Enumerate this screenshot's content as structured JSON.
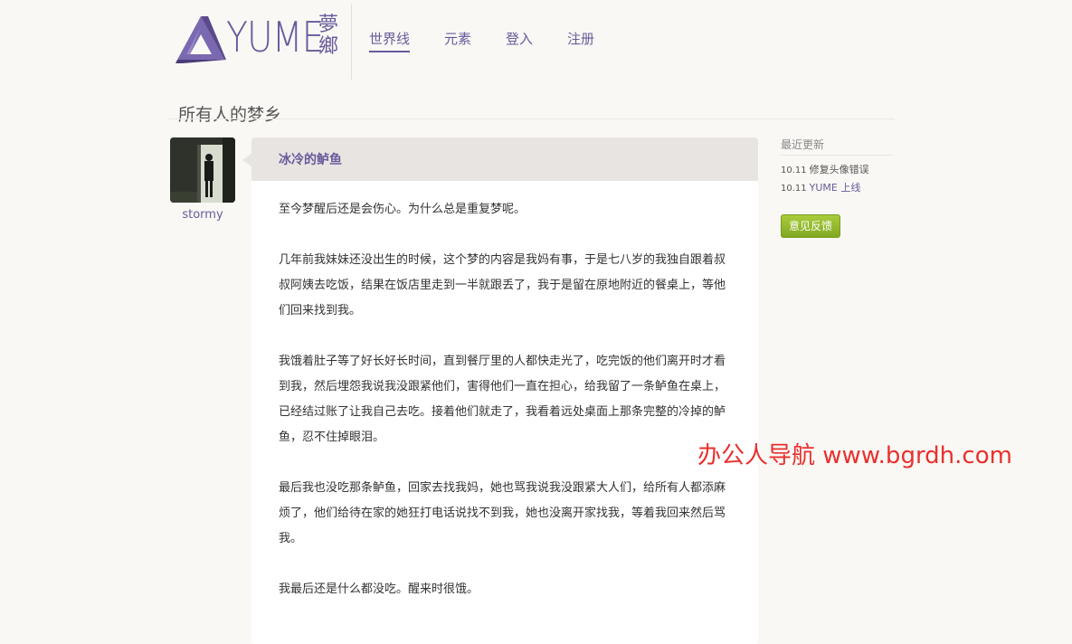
{
  "header": {
    "logo_text": "YUME",
    "logo_kanji": "夢鄉",
    "nav": [
      {
        "label": "世界线",
        "active": true
      },
      {
        "label": "元素",
        "active": false
      },
      {
        "label": "登入",
        "active": false
      },
      {
        "label": "注册",
        "active": false
      }
    ]
  },
  "page_title": "所有人的梦乡",
  "post": {
    "author": "stormy",
    "title": "冰冷的鲈鱼",
    "paragraphs": [
      "至今梦醒后还是会伤心。为什么总是重复梦呢。",
      "几年前我妹妹还没出生的时候，这个梦的内容是我妈有事，于是七八岁的我独自跟着叔叔阿姨去吃饭，结果在饭店里走到一半就跟丢了，我于是留在原地附近的餐桌上，等他们回来找到我。",
      "我饿着肚子等了好长好长时间，直到餐厅里的人都快走光了，吃完饭的他们离开时才看到我，然后埋怨我说我没跟紧他们，害得他们一直在担心，给我留了一条鲈鱼在桌上，已经结过账了让我自己去吃。接着他们就走了，我看着远处桌面上那条完整的冷掉的鲈鱼，忍不住掉眼泪。",
      "最后我也没吃那条鲈鱼，回家去找我妈，她也骂我说我没跟紧大人们，给所有人都添麻烦了，他们给待在家的她狂打电话说找不到我，她也没离开家找我，等着我回来然后骂我。",
      "我最后还是什么都没吃。醒来时很饿。"
    ]
  },
  "sidebar": {
    "heading": "最近更新",
    "updates": [
      {
        "date": "10.11",
        "text": "修复头像错误",
        "link": false
      },
      {
        "date": "10.11",
        "text": "YUME 上线",
        "link": true
      }
    ],
    "feedback_label": "意见反馈"
  },
  "watermark": "办公人导航 www.bgrdh.com",
  "colors": {
    "accent": "#6a5a9c",
    "background": "#f9f8f4",
    "post_header": "#e8e4e1",
    "feedback_green": "#8db52a",
    "watermark_red": "#e8302e"
  }
}
